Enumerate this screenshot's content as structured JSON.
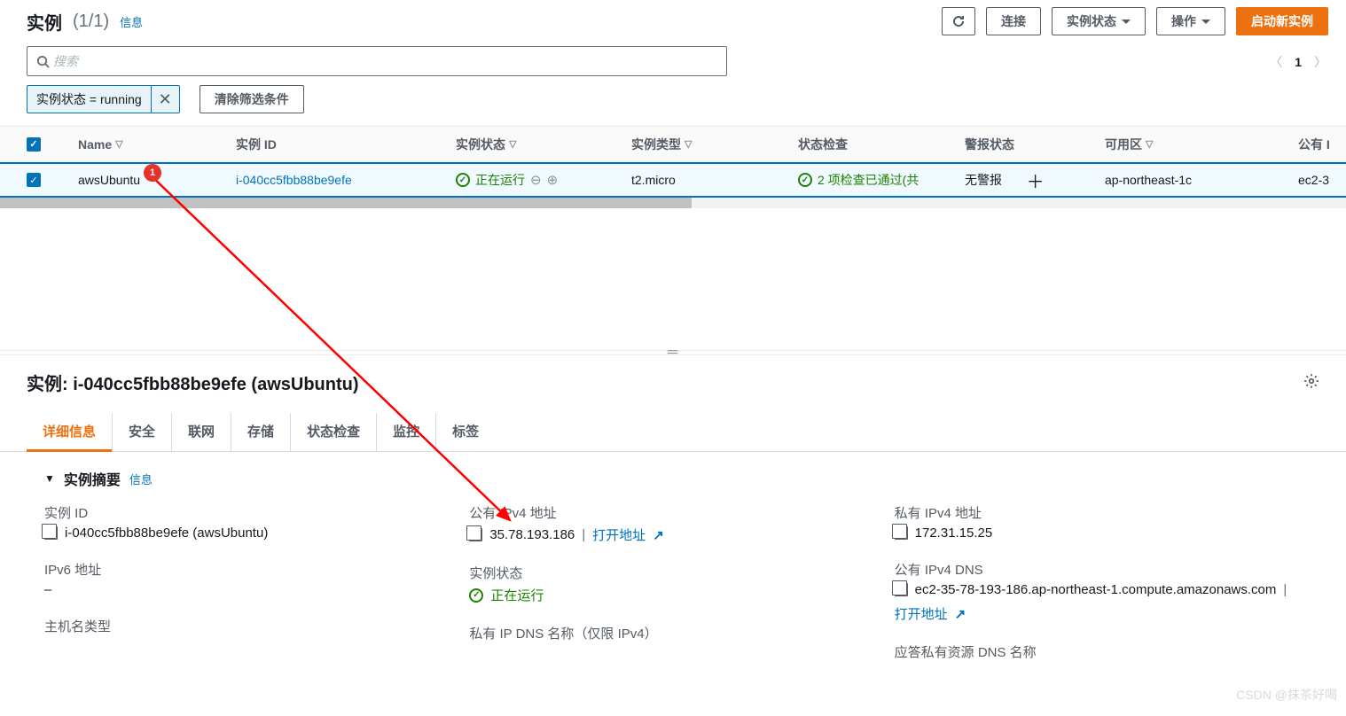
{
  "header": {
    "title": "实例",
    "count": "(1/1)",
    "info": "信息",
    "refresh": "⟳",
    "connect": "连接",
    "stateMenu": "实例状态",
    "actions": "操作",
    "launch": "启动新实例"
  },
  "search": {
    "placeholder": "搜索"
  },
  "filter": {
    "chip": "实例状态 = running",
    "clear": "清除筛选条件"
  },
  "pager": {
    "page": "1"
  },
  "columns": {
    "name": "Name",
    "id": "实例 ID",
    "state": "实例状态",
    "type": "实例类型",
    "check": "状态检查",
    "alarm": "警报状态",
    "az": "可用区",
    "pub": "公有 I"
  },
  "row": {
    "name": "awsUbuntu",
    "id": "i-040cc5fbb88be9efe",
    "state": "正在运行",
    "type": "t2.micro",
    "check": "2 项检查已通过(共",
    "alarm": "无警报",
    "az": "ap-northeast-1c",
    "pub": "ec2-3"
  },
  "annotation": {
    "badge": "1"
  },
  "detail": {
    "title": "实例: i-040cc5fbb88be9efe (awsUbuntu)",
    "tabs": [
      "详细信息",
      "安全",
      "联网",
      "存储",
      "状态检查",
      "监控",
      "标签"
    ],
    "summary": "实例摘要",
    "summaryInfo": "信息",
    "fields": {
      "instanceIdLabel": "实例 ID",
      "instanceId": "i-040cc5fbb88be9efe (awsUbuntu)",
      "ipv6Label": "IPv6 地址",
      "ipv6": "–",
      "hostnameTypeLabel": "主机名类型",
      "publicIpv4Label": "公有 IPv4 地址",
      "publicIpv4": "35.78.193.186",
      "openAddr": "打开地址",
      "stateLabel": "实例状态",
      "stateVal": "正在运行",
      "privateDnsLabel": "私有 IP DNS 名称（仅限 IPv4）",
      "privateIpv4Label": "私有 IPv4 地址",
      "privateIpv4": "172.31.15.25",
      "publicDnsLabel": "公有 IPv4 DNS",
      "publicDns": "ec2-35-78-193-186.ap-northeast-1.compute.amazonaws.com",
      "answerDnsLabel": "应答私有资源 DNS 名称"
    }
  },
  "watermark": "CSDN @抹茶好喝"
}
